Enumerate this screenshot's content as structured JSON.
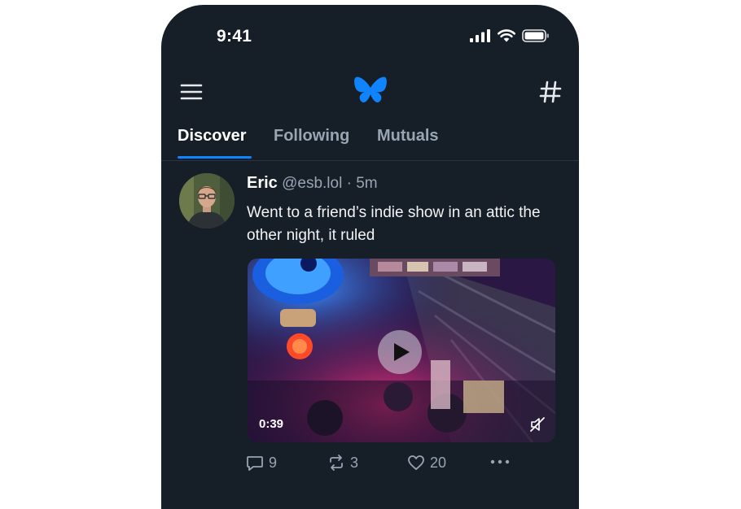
{
  "status_bar": {
    "time": "9:41"
  },
  "header": {
    "menu_icon": "hamburger-menu-icon",
    "logo": "butterfly-logo",
    "feeds_icon": "hashtag-icon"
  },
  "tabs": [
    {
      "label": "Discover",
      "active": true
    },
    {
      "label": "Following",
      "active": false
    },
    {
      "label": "Mutuals",
      "active": false
    }
  ],
  "post": {
    "author_name": "Eric",
    "author_handle": "@esb.lol",
    "separator": "·",
    "time": "5m",
    "text": "Went to a friend’s indie show in an attic the other night, it ruled",
    "video": {
      "duration": "0:39",
      "muted": true
    },
    "reply_count": "9",
    "repost_count": "3",
    "like_count": "20"
  },
  "colors": {
    "background": "#161e27",
    "accent": "#1083fe",
    "muted_text": "#98a5b3"
  }
}
